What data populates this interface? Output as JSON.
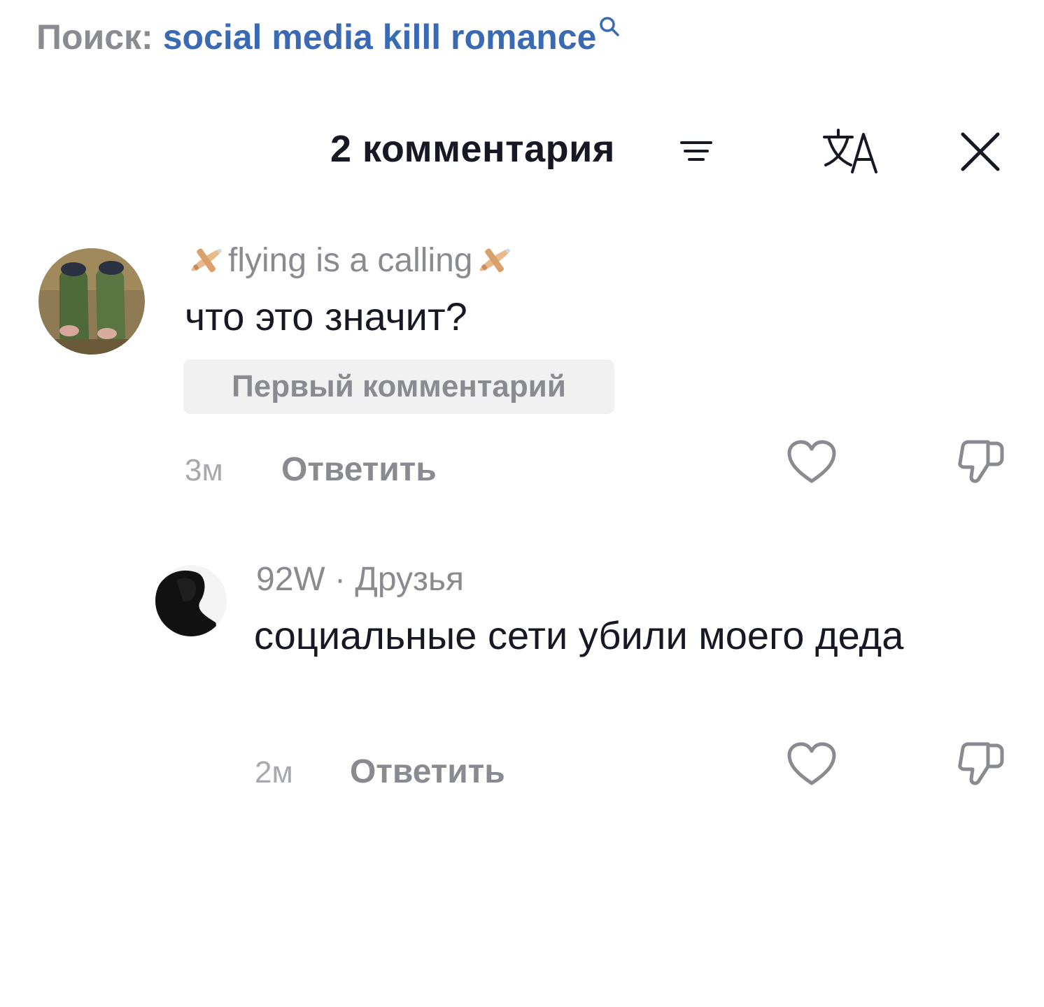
{
  "search": {
    "prefix": "Поиск:",
    "query": "social media killl romance",
    "icon": "search-icon"
  },
  "header": {
    "title": "2 комментария",
    "sort_icon": "sort-icon",
    "translate_icon": "translate-icon",
    "close_icon": "close-icon"
  },
  "comments": [
    {
      "username": "flying is a calling",
      "username_decoration": "airplane-emoji",
      "text": "что это значит?",
      "badge": "Первый комментарий",
      "time": "3м",
      "reply_label": "Ответить"
    },
    {
      "username": "92W · Друзья",
      "text": "социальные сети убили моего деда",
      "time": "2м",
      "reply_label": "Ответить"
    }
  ],
  "colors": {
    "link_blue": "#3a6ab3",
    "muted_gray": "#8a8b91",
    "text_dark": "#161823",
    "badge_bg": "#f1f1f2"
  }
}
